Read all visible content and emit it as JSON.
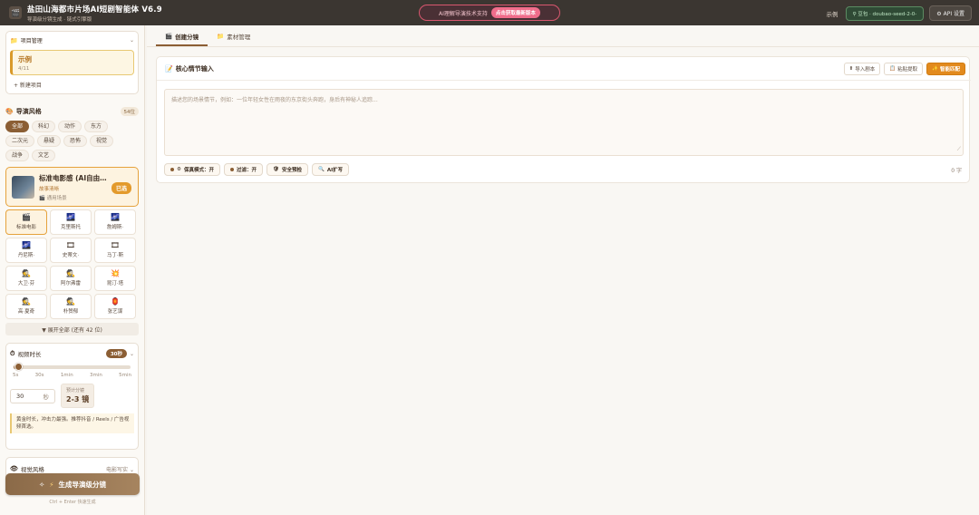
{
  "header": {
    "logo_glyph": "🎬",
    "title": "盐田山海都市片场AI短剧智能体 V6.9",
    "subtitle": "导演级分镜生成 · 链式引擎版",
    "promo_text": "AI理解导演技术支持",
    "promo_button": "点击获取最新版本",
    "project_name": "示例",
    "model_label": "豆包 · doubao-seed-2-0-",
    "api_label": "API 设置"
  },
  "sidebar": {
    "project_section": {
      "title": "项目管理",
      "project": {
        "name": "示例",
        "date": "4/11"
      },
      "new_label": "+ 新建项目"
    },
    "style_section": {
      "title": "导演风格",
      "count": "54位",
      "chips": [
        "全部",
        "科幻",
        "动作",
        "东方",
        "二次元",
        "悬疑",
        "恐怖",
        "视觉",
        "战争",
        "文艺"
      ],
      "active_chip": 0,
      "selected": {
        "name": "标准电影感 (AI自由…",
        "tag": "故事清晰",
        "sub": "🎬 通用场景",
        "badge": "已选"
      },
      "directors": [
        {
          "icon": "🎬",
          "label": "标准电影"
        },
        {
          "icon": "🌌",
          "label": "克里斯托"
        },
        {
          "icon": "🌌",
          "label": "詹姆斯·"
        },
        {
          "icon": "🌌",
          "label": "丹尼斯·"
        },
        {
          "icon": "🎞",
          "label": "史蒂文·"
        },
        {
          "icon": "🎞",
          "label": "马丁·斯"
        },
        {
          "icon": "🕵",
          "label": "大卫·芬"
        },
        {
          "icon": "🕵",
          "label": "阿尔弗雷"
        },
        {
          "icon": "💥",
          "label": "昆汀·塔"
        },
        {
          "icon": "🕵",
          "label": "高·夏奇"
        },
        {
          "icon": "🕵",
          "label": "朴赞郁"
        },
        {
          "icon": "🏮",
          "label": "张艺谋"
        }
      ],
      "active_director": 0,
      "expand_label": "▼ 展开全部 (还有 42 位)"
    },
    "duration_section": {
      "title": "视频时长",
      "badge": "30秒",
      "slider_fraction": 0.04,
      "ticks": [
        "5s",
        "30s",
        "1min",
        "3min",
        "5min"
      ],
      "value": "30",
      "unit": "秒",
      "estimate_label": "预计分镜",
      "estimate_value": "2-3 镜",
      "tip": "黄金时长，冲击力最强。推荐抖音 / Reels / 广告视频首选。"
    },
    "visual_section": {
      "title": "视觉风格",
      "value": "电影写实"
    },
    "generate_label": "生成导演级分镜",
    "generate_hint": "Ctrl + Enter 快速生成"
  },
  "main": {
    "tabs": [
      {
        "icon": "🎬",
        "label": "创建分镜"
      },
      {
        "icon": "📁",
        "label": "素材管理"
      }
    ],
    "panel": {
      "title": "核心情节输入",
      "buttons": {
        "import": "导入剧本",
        "paste": "粘贴提取",
        "smart": "智能匹配"
      },
      "placeholder": "描述您的场景情节，例如：一位年轻女性在雨夜的东京街头奔跑，身后有神秘人追踪...",
      "options": [
        {
          "label": "保真模式：开",
          "icon": "⚙"
        },
        {
          "label": "过滤：开",
          "icon": ""
        },
        {
          "label": "安全预检",
          "icon": "🛡"
        },
        {
          "label": "AI扩写",
          "icon": "🔍"
        }
      ],
      "char_count": "0 字"
    }
  }
}
